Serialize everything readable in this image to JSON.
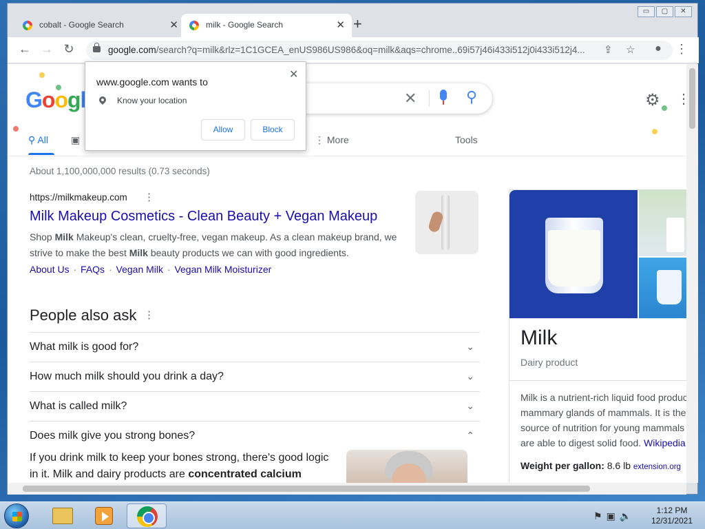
{
  "window": {
    "tabs": [
      {
        "title": "cobalt - Google Search",
        "close": "✕"
      },
      {
        "title": "milk - Google Search",
        "close": "✕"
      }
    ],
    "new_tab": "+",
    "controls": {
      "minimize": "▭",
      "maximize": "▢",
      "close": "✕"
    }
  },
  "toolbar": {
    "back": "←",
    "forward": "→",
    "reload": "↻",
    "url_host": "google.com",
    "url_rest": "/search?q=milk&rlz=1C1GCEA_enUS986US986&oq=milk&aqs=chrome..69i57j46i433i512j0i433i512j4...",
    "share": "⇪",
    "star": "☆",
    "profile": "●",
    "menu": "⋮"
  },
  "search": {
    "clear": "✕",
    "search_icon": "⚲",
    "settings_icon": "⚙",
    "apps_icon": "⋮",
    "tabs": {
      "all": "All",
      "more": "⋮ More",
      "tools": "Tools"
    }
  },
  "permission_popup": {
    "title": "www.google.com wants to",
    "close": "✕",
    "permission": "Know your location",
    "allow": "Allow",
    "block": "Block"
  },
  "results": {
    "stats": "About 1,100,000,000 results (0.73 seconds)",
    "first": {
      "url": "https://milkmakeup.com",
      "menu": "⋮",
      "title": "Milk Makeup Cosmetics - Clean Beauty + Vegan Makeup",
      "snippet_1": "Shop ",
      "snippet_b1": "Milk",
      "snippet_2": " Makeup's clean, cruelty-free, vegan makeup. As a clean makeup brand, we strive to make the best ",
      "snippet_b2": "Milk",
      "snippet_3": " beauty products we can with good ingredients.",
      "sitelinks": [
        "About Us",
        "FAQs",
        "Vegan Milk",
        "Vegan Milk Moisturizer"
      ],
      "sitelink_sep": "·"
    },
    "people_also_ask": {
      "title": "People also ask",
      "menu": "⋮",
      "questions": [
        {
          "q": "What milk is good for?",
          "chevron": "⌄"
        },
        {
          "q": "How much milk should you drink a day?",
          "chevron": "⌄"
        },
        {
          "q": "What is called milk?",
          "chevron": "⌄"
        },
        {
          "q": "Does milk give you strong bones?",
          "chevron": "⌃"
        }
      ],
      "answer_1": "If you drink milk to keep your bones strong, there's good logic in it. Milk and dairy products are ",
      "answer_bold": "concentrated calcium"
    }
  },
  "knowledge_panel": {
    "title": "Milk",
    "subtitle": "Dairy product",
    "desc_lines": [
      "Milk is a nutrient-rich liquid food produc",
      "mammary glands of mammals. It is the",
      "source of nutrition for young mammals",
      "are able to digest solid food. "
    ],
    "wiki": "Wikipedia",
    "fact_label": "Weight per gallon:",
    "fact_value": " 8.6 lb ",
    "fact_source": "extension.org"
  },
  "taskbar": {
    "tray": [
      "⚑",
      "▣",
      "🔈"
    ],
    "time": "1:12 PM",
    "date": "12/31/2021"
  }
}
